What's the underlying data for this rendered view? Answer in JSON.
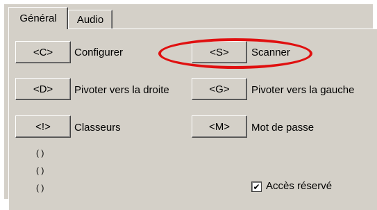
{
  "tabs": [
    {
      "label": "Général"
    },
    {
      "label": "Audio"
    }
  ],
  "buttons": {
    "configure": {
      "key": "<C>",
      "label": "Configurer"
    },
    "scan": {
      "key": "<S>",
      "label": "Scanner"
    },
    "rotate_right": {
      "key": "<D>",
      "label": "Pivoter vers la droite"
    },
    "rotate_left": {
      "key": "<G>",
      "label": "Pivoter vers la gauche"
    },
    "binders": {
      "key": "<!>",
      "label": "Classeurs"
    },
    "password": {
      "key": "<M>",
      "label": "Mot de passe"
    }
  },
  "small_items": [
    "( )",
    "( )",
    "( )"
  ],
  "checkbox": {
    "label": "Accès réservé",
    "checked": true,
    "mark": "✔"
  },
  "annotation_color": "#e01010"
}
